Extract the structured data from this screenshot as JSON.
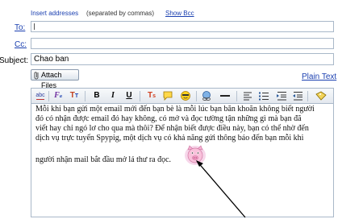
{
  "header": {
    "insert_addresses": "Insert addresses",
    "separator_hint": "(separated by commas)",
    "show_bcc": "Show Bcc"
  },
  "fields": {
    "to_label": "To:",
    "to_value": "",
    "cc_label": "Cc:",
    "cc_value": "",
    "subject_label": "Subject:",
    "subject_value": "Chao ban"
  },
  "actions": {
    "attach_files": "Attach Files",
    "plain_text": "Plain Text"
  },
  "toolbar": {
    "items": [
      "spell-check",
      "font",
      "font-size",
      "bold",
      "italic",
      "underline",
      "text-color",
      "emoticon",
      "smiley",
      "link",
      "horizontal-rule",
      "align-left",
      "align-center",
      "indent",
      "stationery"
    ],
    "colors": {
      "accent": "#1a3fb0",
      "border": "#a9b8c9"
    }
  },
  "editor": {
    "line1": "Mỗi khi bạn gửi một email mới đến bạn bè là mỗi lúc bạn băn khoăn không biết người",
    "line2": "đó có nhận được email đó hay không, có mở và đọc tường tận những gì mà bạn đã",
    "line3": "viết hay chỉ ngó lơ cho qua mà thôi? Để nhận biết được điều này, bạn có thể nhờ đến",
    "line4": "dịch vụ trực tuyến Spypig, một dịch vụ có khả năng gửi thông báo đến bạn mỗi khi",
    "line5": "người nhận mail bắt đầu mở lá thư ra đọc.",
    "inserted_image": "pig-icon"
  }
}
